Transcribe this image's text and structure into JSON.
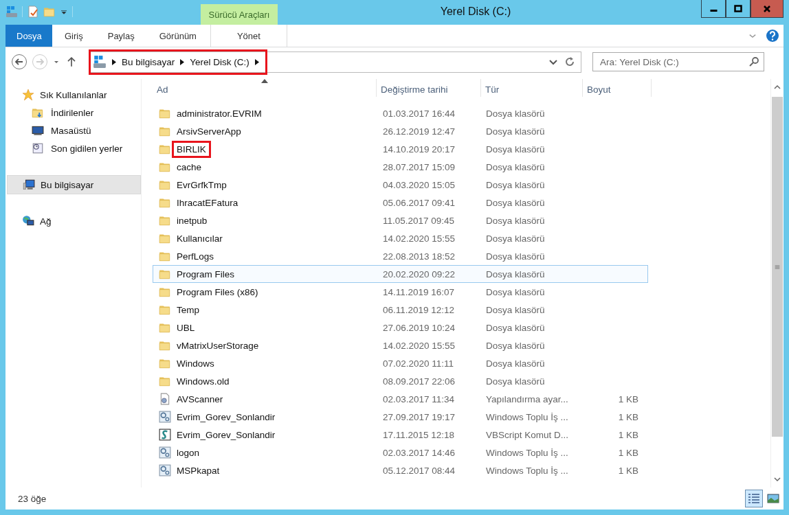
{
  "window": {
    "title": "Yerel Disk (C:)"
  },
  "ribbon": {
    "contextual_group": "Sürücü Araçları",
    "tabs": [
      {
        "label": "Dosya",
        "kind": "file",
        "selected": false
      },
      {
        "label": "Giriş",
        "kind": "normal",
        "selected": false
      },
      {
        "label": "Paylaş",
        "kind": "normal",
        "selected": false
      },
      {
        "label": "Görünüm",
        "kind": "normal",
        "selected": false
      },
      {
        "label": "Yönet",
        "kind": "contextual",
        "selected": false
      }
    ]
  },
  "address_bar": {
    "breadcrumb": [
      "Bu bilgisayar",
      "Yerel Disk (C:)"
    ],
    "highlighted": true
  },
  "search": {
    "placeholder": "Ara: Yerel Disk (C:)"
  },
  "sidebar": {
    "items": [
      {
        "label": "Sık Kullanılanlar",
        "kind": "favorites",
        "selected": false,
        "children": [
          {
            "label": "İndirilenler",
            "kind": "downloads",
            "selected": false
          },
          {
            "label": "Masaüstü",
            "kind": "desktop",
            "selected": false
          },
          {
            "label": "Son gidilen yerler",
            "kind": "recent",
            "selected": false
          }
        ]
      },
      {
        "label": "Bu bilgisayar",
        "kind": "computer",
        "selected": true
      },
      {
        "label": "Ağ",
        "kind": "network",
        "selected": false
      }
    ]
  },
  "table": {
    "columns": [
      {
        "label": "Ad",
        "sorted": true
      },
      {
        "label": "Değiştirme tarihi",
        "sorted": false
      },
      {
        "label": "Tür",
        "sorted": false
      },
      {
        "label": "Boyut",
        "sorted": false
      }
    ],
    "rows": [
      {
        "name": "administrator.EVRIM",
        "modified": "01.03.2017 16:44",
        "type": "Dosya klasörü",
        "kind": "folder",
        "hovered": false,
        "highlighted": false
      },
      {
        "name": "ArsivServerApp",
        "modified": "26.12.2019 12:47",
        "type": "Dosya klasörü",
        "kind": "folder",
        "hovered": false,
        "highlighted": false
      },
      {
        "name": "BIRLIK",
        "modified": "14.10.2019 20:17",
        "type": "Dosya klasörü",
        "kind": "folder",
        "hovered": false,
        "highlighted": true
      },
      {
        "name": "cache",
        "modified": "28.07.2017 15:09",
        "type": "Dosya klasörü",
        "kind": "folder",
        "hovered": false,
        "highlighted": false
      },
      {
        "name": "EvrGrfkTmp",
        "modified": "04.03.2020 15:05",
        "type": "Dosya klasörü",
        "kind": "folder",
        "hovered": false,
        "highlighted": false
      },
      {
        "name": "IhracatEFatura",
        "modified": "05.06.2017 09:41",
        "type": "Dosya klasörü",
        "kind": "folder",
        "hovered": false,
        "highlighted": false
      },
      {
        "name": "inetpub",
        "modified": "11.05.2017 09:45",
        "type": "Dosya klasörü",
        "kind": "folder",
        "hovered": false,
        "highlighted": false
      },
      {
        "name": "Kullanıcılar",
        "modified": "14.02.2020 15:55",
        "type": "Dosya klasörü",
        "kind": "folder",
        "hovered": false,
        "highlighted": false
      },
      {
        "name": "PerfLogs",
        "modified": "22.08.2013 18:52",
        "type": "Dosya klasörü",
        "kind": "folder",
        "hovered": false,
        "highlighted": false
      },
      {
        "name": "Program Files",
        "modified": "20.02.2020 09:22",
        "type": "Dosya klasörü",
        "kind": "folder",
        "hovered": true,
        "highlighted": false
      },
      {
        "name": "Program Files (x86)",
        "modified": "14.11.2019 16:07",
        "type": "Dosya klasörü",
        "kind": "folder",
        "hovered": false,
        "highlighted": false
      },
      {
        "name": "Temp",
        "modified": "06.11.2019 12:12",
        "type": "Dosya klasörü",
        "kind": "folder",
        "hovered": false,
        "highlighted": false
      },
      {
        "name": "UBL",
        "modified": "27.06.2019 10:24",
        "type": "Dosya klasörü",
        "kind": "folder",
        "hovered": false,
        "highlighted": false
      },
      {
        "name": "vMatrixUserStorage",
        "modified": "14.02.2020 15:55",
        "type": "Dosya klasörü",
        "kind": "folder",
        "hovered": false,
        "highlighted": false
      },
      {
        "name": "Windows",
        "modified": "07.02.2020 11:11",
        "type": "Dosya klasörü",
        "kind": "folder",
        "hovered": false,
        "highlighted": false
      },
      {
        "name": "Windows.old",
        "modified": "08.09.2017 22:06",
        "type": "Dosya klasörü",
        "kind": "folder",
        "hovered": false,
        "highlighted": false
      },
      {
        "name": "AVScanner",
        "modified": "02.03.2017 11:34",
        "type": "Yapılandırma ayar...",
        "size": "1 KB",
        "kind": "config",
        "hovered": false,
        "highlighted": false
      },
      {
        "name": "Evrim_Gorev_Sonlandir",
        "modified": "27.09.2017 19:17",
        "type": "Windows Toplu İş ...",
        "size": "1 KB",
        "kind": "batch",
        "hovered": false,
        "highlighted": false
      },
      {
        "name": "Evrim_Gorev_Sonlandir",
        "modified": "17.11.2015 12:18",
        "type": "VBScript Komut D...",
        "size": "1 KB",
        "kind": "script",
        "hovered": false,
        "highlighted": false
      },
      {
        "name": "logon",
        "modified": "02.03.2017 14:46",
        "type": "Windows Toplu İş ...",
        "size": "1 KB",
        "kind": "batch",
        "hovered": false,
        "highlighted": false
      },
      {
        "name": "MSPkapat",
        "modified": "05.12.2017 08:44",
        "type": "Windows Toplu İş ...",
        "size": "1 KB",
        "kind": "batch",
        "hovered": false,
        "highlighted": false
      }
    ]
  },
  "status_bar": {
    "item_count": "23 öğe",
    "view_buttons": [
      {
        "kind": "details",
        "selected": true
      },
      {
        "kind": "thumbnails",
        "selected": false
      }
    ]
  }
}
